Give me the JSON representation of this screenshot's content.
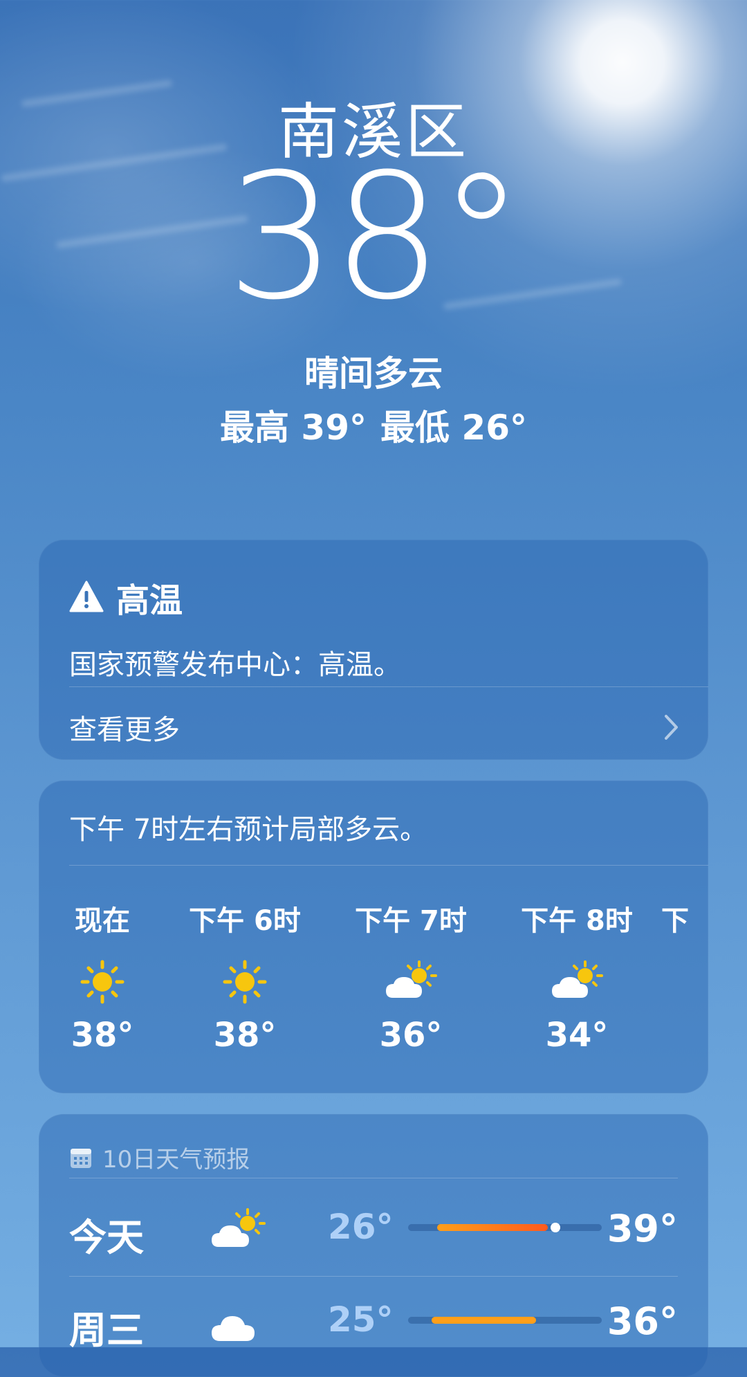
{
  "location": {
    "city": "南溪区",
    "temperature": "38°",
    "condition": "晴间多云",
    "high": "最高 39°",
    "low": "最低 26°"
  },
  "alert": {
    "title": "高温",
    "description": "国家预警发布中心：高温。",
    "see_more": "查看更多",
    "icons": [
      "warning-icon",
      "chevron-right-icon"
    ]
  },
  "hourly": {
    "summary": "下午 7时左右预计局部多云。",
    "items": [
      {
        "time": "现在",
        "icon": "sunny-icon",
        "temp": "38°"
      },
      {
        "time": "下午 6时",
        "icon": "sunny-icon",
        "temp": "38°"
      },
      {
        "time": "下午 7时",
        "icon": "partly-cloudy-icon",
        "temp": "36°"
      },
      {
        "time": "下午 8时",
        "icon": "partly-cloudy-icon",
        "temp": "34°"
      },
      {
        "time": "下",
        "icon": "",
        "temp": ""
      }
    ]
  },
  "forecast": {
    "header": "10日天气预报",
    "header_icon": "calendar-icon",
    "days": [
      {
        "day": "今天",
        "icon": "partly-cloudy-icon",
        "low": "26°",
        "high": "39°",
        "range_start": 0.15,
        "range_end": 0.72,
        "current": 0.76
      },
      {
        "day": "周三",
        "icon": "cloudy-icon",
        "low": "25°",
        "high": "36°",
        "range_start": 0.12,
        "range_end": 0.66
      }
    ]
  },
  "colors": {
    "sun": "#f7c60e",
    "bar_hot": "#ff5a1e",
    "bar_warm": "#ff9f1a",
    "bar_track": "#1e4f8c"
  }
}
